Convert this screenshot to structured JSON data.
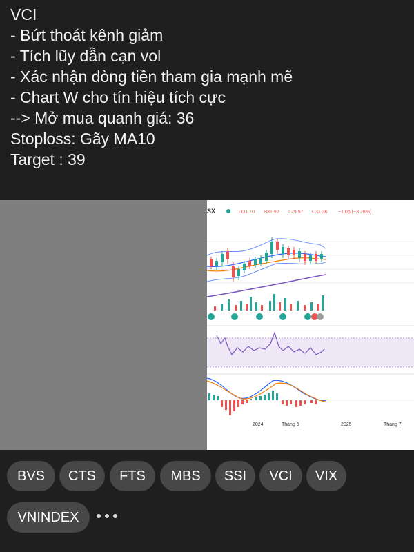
{
  "message": {
    "lines": [
      "VCI",
      "- Bứt thoát kênh giảm",
      "- Tích lũy dẫn cạn vol",
      "- Xác nhận dòng tiền tham gia mạnh mẽ",
      "- Chart W cho tín hiệu tích cực",
      "--> Mở mua quanh giá: 36",
      "Stoploss: Gãy MA10",
      "Target : 39"
    ]
  },
  "chart_image": {
    "exchange_label": "SX",
    "ohlc": {
      "open": "O31.70",
      "high": "H31.92",
      "low": "L29.57",
      "close": "C31.36",
      "change": "−1.06 (−3.28%)"
    },
    "time_labels": [
      "2024",
      "Tháng 6",
      "2025",
      "Tháng 7"
    ],
    "colors": {
      "up": "#26a69a",
      "down": "#ef5350",
      "band": "#2962ff",
      "ma": "#f57c00",
      "long_ma": "#7e57c2"
    }
  },
  "tags": {
    "items": [
      "BVS",
      "CTS",
      "FTS",
      "MBS",
      "SSI",
      "VCI",
      "VIX",
      "VNINDEX"
    ],
    "more_icon": "ellipsis-icon"
  }
}
